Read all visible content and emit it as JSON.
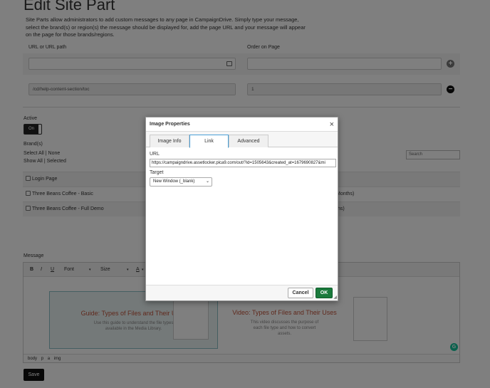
{
  "page": {
    "title": "Edit Site Part",
    "description": "Site Parts allow administrators to add custom messages to any page in CampaignDrive. Simply type your message, select the brand(s) or region(s) the message should be displayed for, add the page URL and your message will appear on the page for those brands/regions."
  },
  "fields": {
    "url_label": "URL or URL path",
    "order_label": "Order on Page",
    "existing_url": "/cd/help-content-section/toc",
    "existing_order": "1",
    "add_icon": "plus-circle-icon",
    "remove_icon": "minus-circle-icon"
  },
  "active": {
    "label": "Active",
    "toggle_label": "On"
  },
  "brands": {
    "label": "Brand(s)",
    "select_all": "Select All",
    "none": "None",
    "show_all": "Show All",
    "selected": "Selected",
    "separator": "|",
    "search_placeholder": "Search",
    "rows": [
      {
        "name": "Login Page",
        "right": ""
      },
      {
        "name": "Three Beans Coffee - Basic",
        "right": "Months)"
      },
      {
        "name": "Three Beans Coffee - Full Demo",
        "right": "ths)"
      }
    ]
  },
  "message": {
    "label": "Message",
    "toolbar": {
      "bold": "B",
      "italic": "I",
      "underline": "U",
      "font": "Font",
      "size": "Size",
      "font_color": "A"
    },
    "cards": [
      {
        "title": "Guide: Types of Files and Their Uses",
        "desc": "Use this guide to understand the file types available in the Media Library."
      },
      {
        "title": "Video: Types of Files and Their Uses",
        "desc": "This video discusses the purpose of each file type and how to convert assets."
      }
    ],
    "path": [
      "body",
      "p",
      "a",
      "img"
    ]
  },
  "save_label": "Save",
  "grammarly_label": "G",
  "dialog": {
    "title": "Image Properties",
    "close": "×",
    "tabs": [
      "Image Info",
      "Link",
      "Advanced"
    ],
    "active_tab": "Link",
    "url_label": "URL",
    "url_value": "https://campaigndrive.assetlocker.pica9.com/out/?id=1505643&created_at=1679690827&mi",
    "target_label": "Target",
    "target_value": "New Window (_blank)",
    "cancel": "Cancel",
    "ok": "OK"
  },
  "colors": {
    "ok_green": "#1a7a3c",
    "active_tab_border": "#4a9fd6",
    "card_title": "#c0533a"
  }
}
